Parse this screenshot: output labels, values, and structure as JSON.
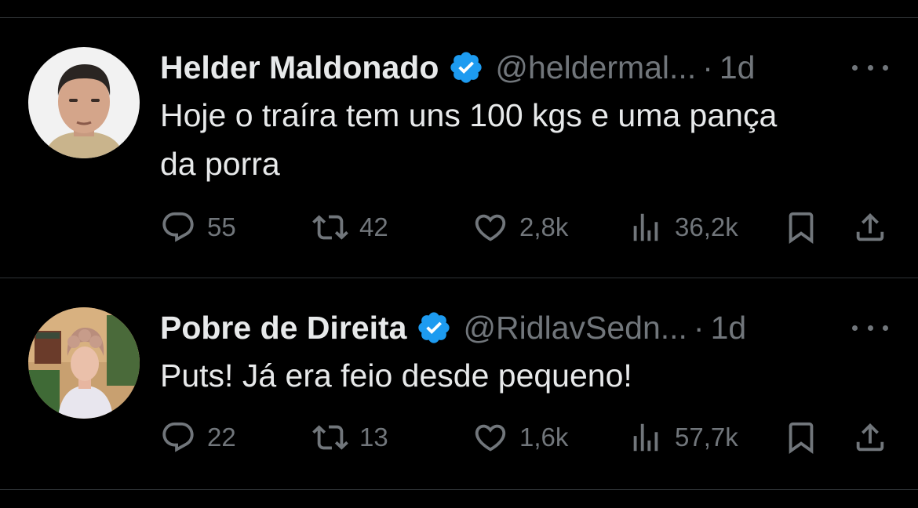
{
  "colors": {
    "background": "#000000",
    "text": "#e7e9ea",
    "muted": "#71767b",
    "verified": "#1d9bf0",
    "divider": "#2f3336"
  },
  "tweets": [
    {
      "name": "Helder Maldonado",
      "handle": "@heldermal...",
      "separator": "·",
      "time": "1d",
      "text_line1": "Hoje o traíra tem uns 100 kgs e uma pança",
      "text_line2": "da porra",
      "replies": "55",
      "retweets": "42",
      "likes": "2,8k",
      "views": "36,2k",
      "icons": [
        "reply-icon",
        "retweet-icon",
        "like-icon",
        "views-icon",
        "bookmark-icon",
        "share-icon"
      ]
    },
    {
      "name": "Pobre de Direita",
      "handle": "@RidlavSedn...",
      "separator": "·",
      "time": "1d",
      "text_line1": "Puts! Já era feio desde pequeno!",
      "replies": "22",
      "retweets": "13",
      "likes": "1,6k",
      "views": "57,7k",
      "icons": [
        "reply-icon",
        "retweet-icon",
        "like-icon",
        "views-icon",
        "bookmark-icon",
        "share-icon"
      ]
    }
  ]
}
